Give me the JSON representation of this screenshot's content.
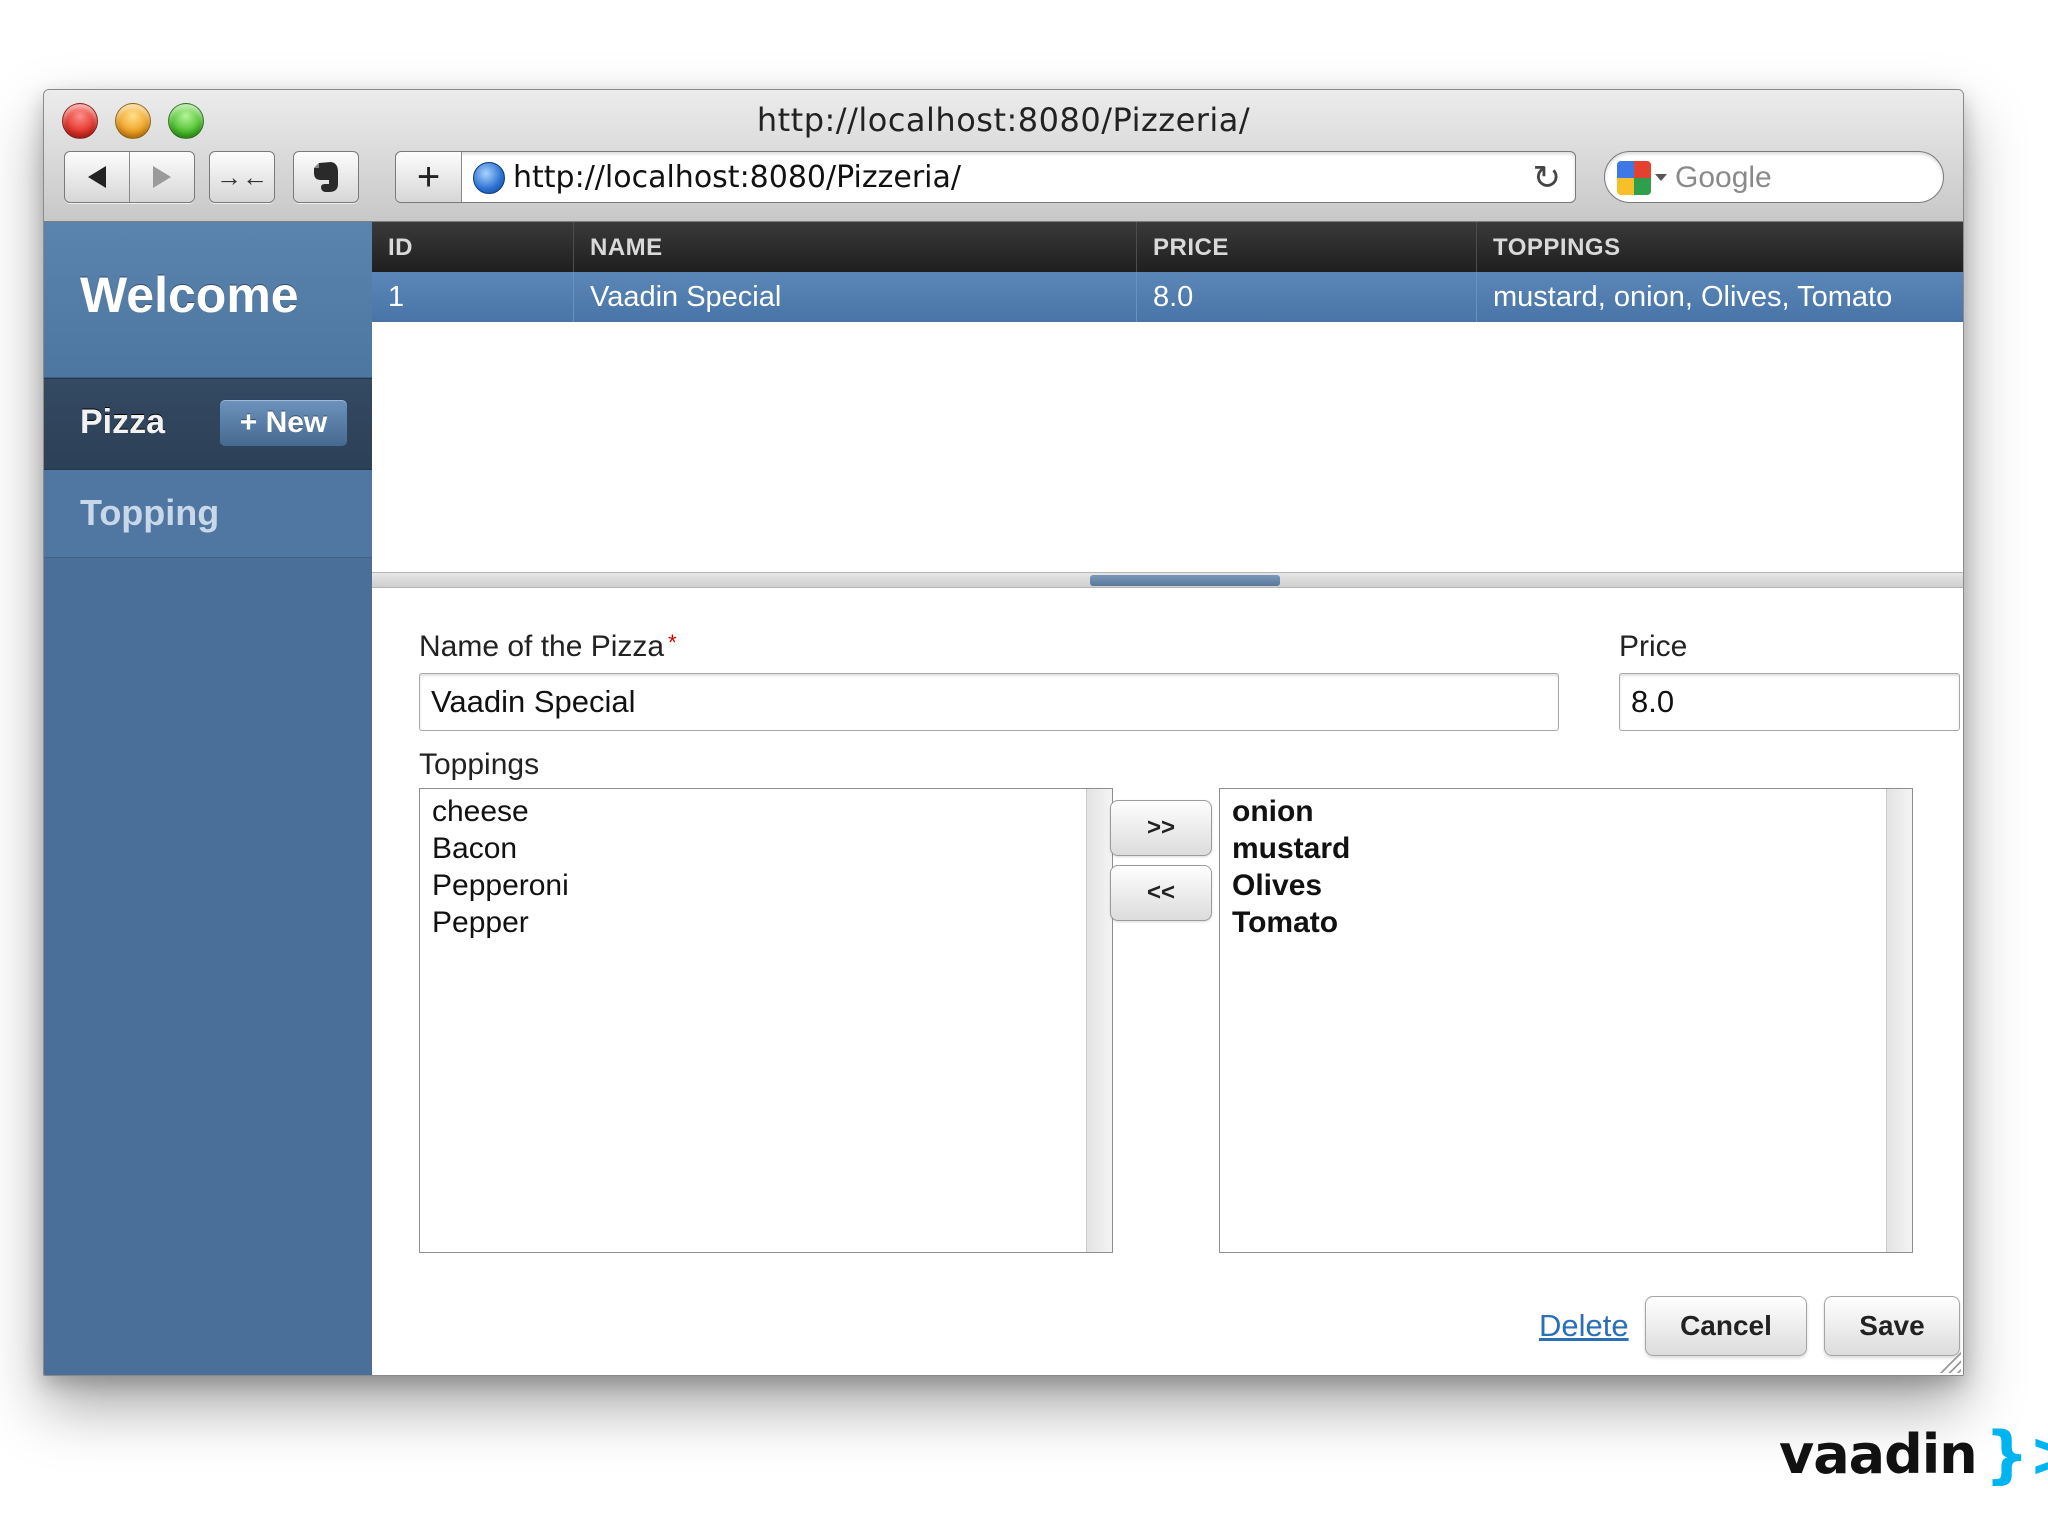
{
  "browser": {
    "window_title": "http://localhost:8080/Pizzeria/",
    "url": "http://localhost:8080/Pizzeria/",
    "search_placeholder": "Google"
  },
  "sidebar": {
    "welcome": "Welcome",
    "items": [
      {
        "label": "Pizza",
        "selected": true
      },
      {
        "label": "Topping",
        "selected": false
      }
    ],
    "new_button": "+ New"
  },
  "grid": {
    "columns": [
      "ID",
      "NAME",
      "PRICE",
      "TOPPINGS"
    ],
    "rows": [
      {
        "id": "1",
        "name": "Vaadin Special",
        "price": "8.0",
        "toppings": "mustard, onion, Olives, Tomato",
        "selected": true
      }
    ]
  },
  "form": {
    "name_label": "Name of the Pizza",
    "name_required": "*",
    "name_value": "Vaadin Special",
    "price_label": "Price",
    "price_value": "8.0",
    "toppings_label": "Toppings",
    "available_toppings": [
      "cheese",
      "Bacon",
      "Pepperoni",
      "Pepper"
    ],
    "selected_toppings": [
      "onion",
      "mustard",
      "Olives",
      "Tomato"
    ],
    "add_button": ">>",
    "remove_button": "<<",
    "delete_link": "Delete",
    "cancel_button": "Cancel",
    "save_button": "Save"
  },
  "branding": {
    "logo_text": "vaadin",
    "logo_mark": "}>",
    "accent_color": "#00b4f0",
    "sidebar_color": "#4a6f98",
    "selection_color": "#5b86b8"
  }
}
